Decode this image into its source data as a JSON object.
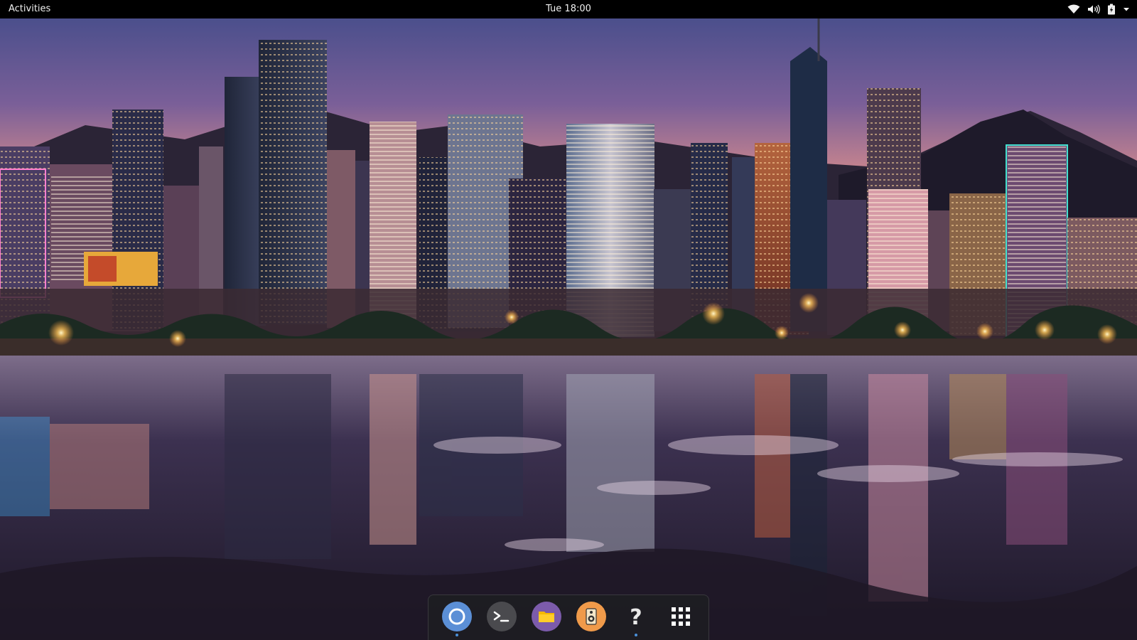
{
  "topbar": {
    "activities_label": "Activities",
    "clock": "Tue 18:00",
    "tray_icons": [
      "wifi-icon",
      "volume-icon",
      "battery-icon",
      "dropdown-arrow-icon"
    ]
  },
  "dock": {
    "items": [
      {
        "name": "chromium-browser",
        "icon": "browser-icon",
        "running": true
      },
      {
        "name": "terminal",
        "icon": "terminal-icon",
        "running": false
      },
      {
        "name": "files",
        "icon": "folder-icon",
        "running": false
      },
      {
        "name": "rhythmbox",
        "icon": "speaker-icon",
        "running": false
      },
      {
        "name": "help",
        "icon": "help-icon",
        "running": true
      },
      {
        "name": "show-applications",
        "icon": "app-grid-icon",
        "running": false
      }
    ],
    "help_glyph": "?"
  },
  "colors": {
    "topbar_bg": "#000000",
    "dock_bg": "#1e1e22",
    "accent": "#4a90d9"
  }
}
